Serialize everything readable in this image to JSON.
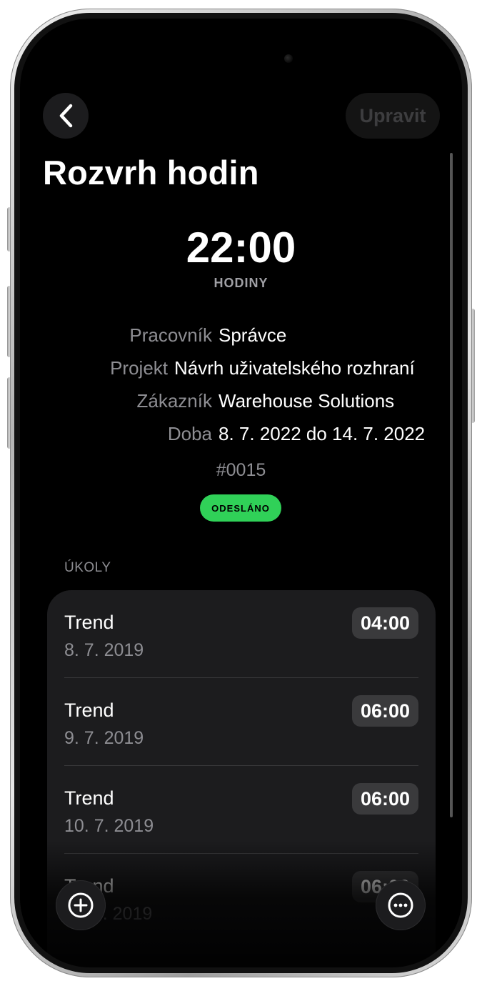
{
  "nav": {
    "back_label": "",
    "edit_label": "Upravit"
  },
  "header": {
    "title": "Rozvrh hodin"
  },
  "summary": {
    "total_hours": "22:00",
    "hours_caption": "HODINY"
  },
  "details": {
    "worker_label": "Pracovník",
    "worker_value": "Správce",
    "project_label": "Projekt",
    "project_value": "Návrh uživatelského rozhraní",
    "customer_label": "Zákazník",
    "customer_value": "Warehouse Solutions",
    "period_label": "Doba",
    "period_value": "8. 7. 2022 do 14. 7. 2022"
  },
  "document": {
    "id": "#0015",
    "status": "ODESLÁNO",
    "status_color": "#30d158"
  },
  "tasks": {
    "header": "ÚKOLY",
    "items": [
      {
        "name": "Trend",
        "date": "8. 7. 2019",
        "hours": "04:00"
      },
      {
        "name": "Trend",
        "date": "9. 7. 2019",
        "hours": "06:00"
      },
      {
        "name": "Trend",
        "date": "10. 7. 2019",
        "hours": "06:00"
      },
      {
        "name": "Trend",
        "date": "11. 7. 2019",
        "hours": "06:00"
      }
    ]
  },
  "toolbar": {
    "add_icon": "plus-circle-icon",
    "more_icon": "ellipsis-circle-icon"
  },
  "colors": {
    "background": "#000000",
    "card": "#1c1c1e",
    "secondary_text": "#8e8e93",
    "accent_green": "#30d158"
  }
}
